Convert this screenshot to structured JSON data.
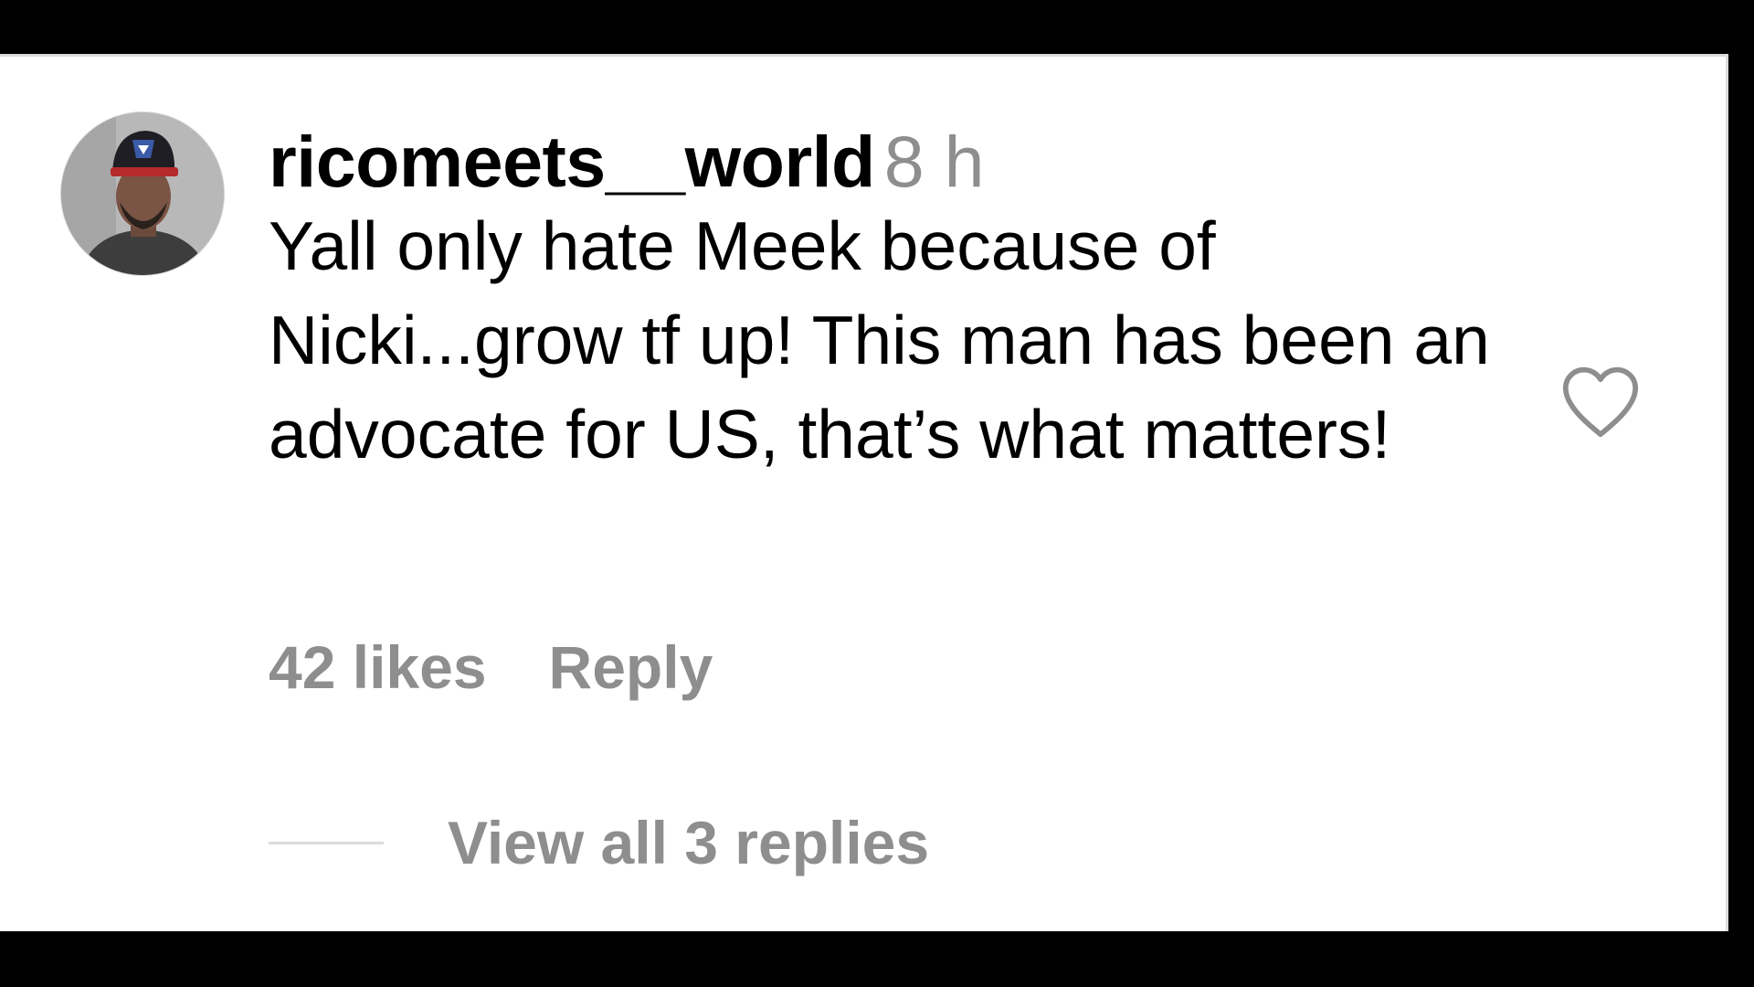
{
  "comment": {
    "username": "ricomeets__world",
    "time": "8 h",
    "text": "Yall only hate Meek because of Nicki...grow tf up! This man has been an advocate for US, that’s what matters!",
    "likes": "42 likes",
    "reply_label": "Reply",
    "view_replies_label": "View all 3 replies",
    "avatar_icon": "user-avatar-icon",
    "like_icon": "heart-outline-icon"
  },
  "colors": {
    "background": "#ffffff",
    "frame": "#000000",
    "primary_text": "#000000",
    "secondary_text": "#8e8e8e",
    "divider": "#dbdbdb"
  }
}
